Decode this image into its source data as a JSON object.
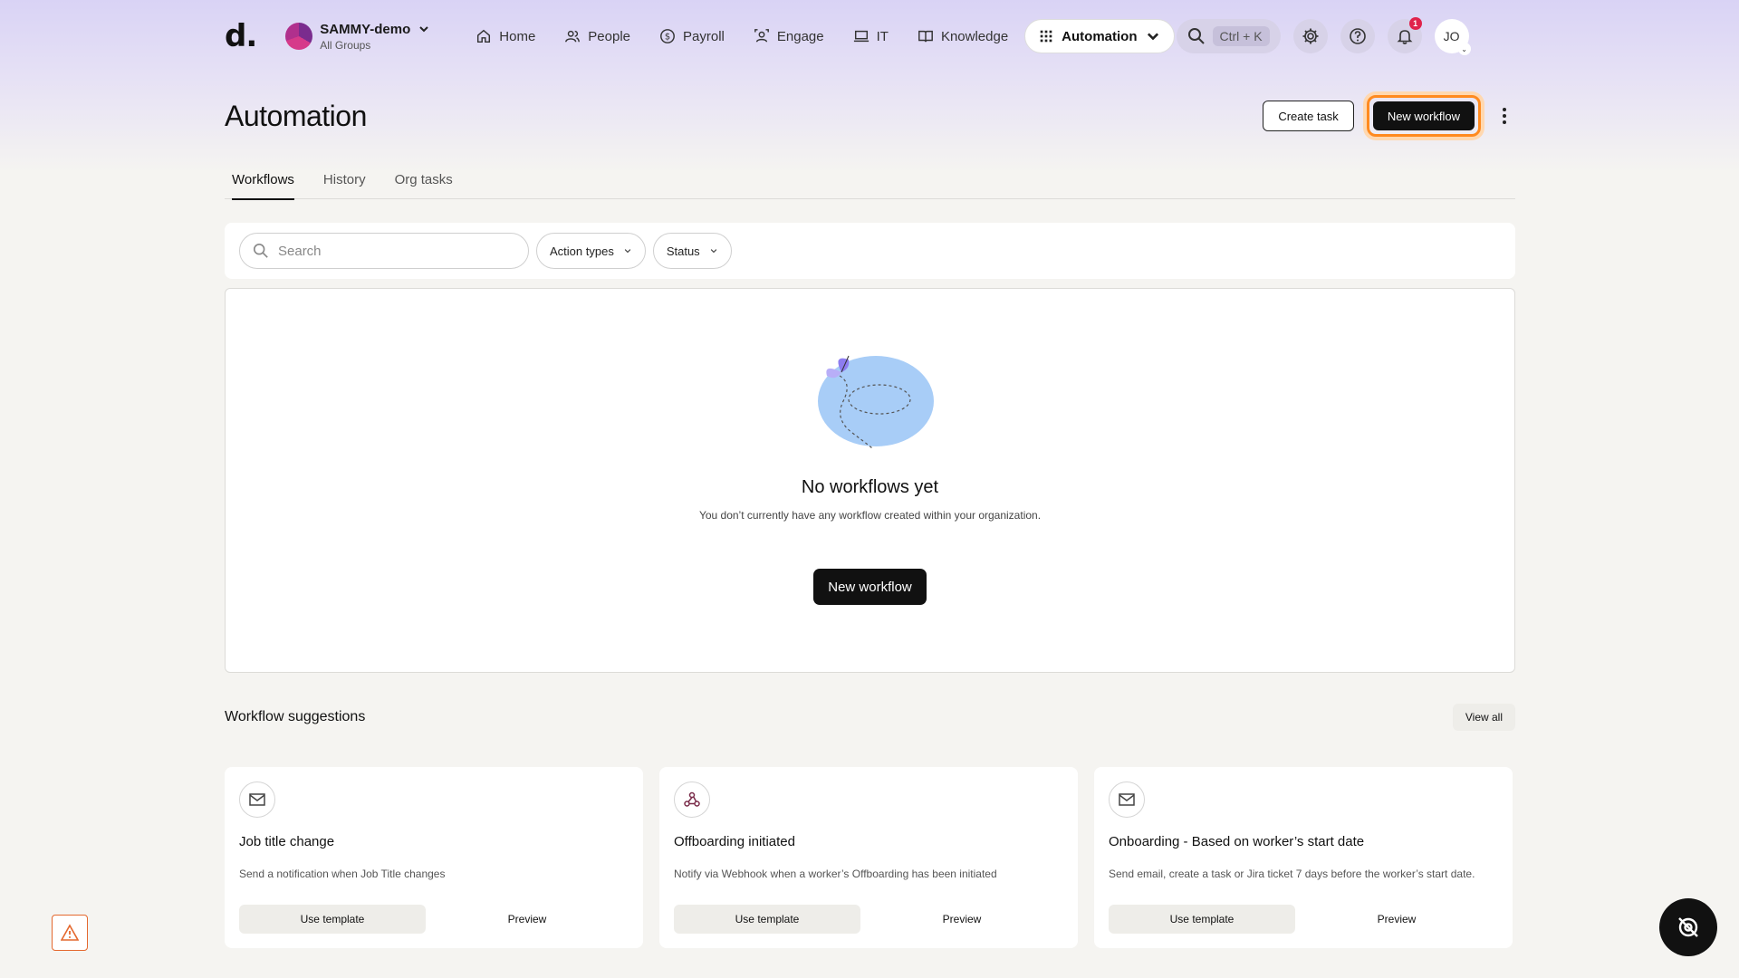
{
  "header": {
    "logo": "d.",
    "org_name": "SAMMY-demo",
    "org_sub": "All Groups",
    "nav": [
      {
        "label": "Home",
        "icon": "home-icon"
      },
      {
        "label": "People",
        "icon": "people-icon"
      },
      {
        "label": "Payroll",
        "icon": "payroll-icon"
      },
      {
        "label": "Engage",
        "icon": "engage-icon"
      },
      {
        "label": "IT",
        "icon": "laptop-icon"
      },
      {
        "label": "Knowledge",
        "icon": "book-icon"
      },
      {
        "label": "Automation",
        "icon": "grid-icon",
        "active": true
      }
    ],
    "search_shortcut": "Ctrl + K",
    "notification_count": "1",
    "user_initials": "JO"
  },
  "page": {
    "title": "Automation",
    "create_task": "Create task",
    "new_workflow": "New workflow"
  },
  "tabs": [
    "Workflows",
    "History",
    "Org tasks"
  ],
  "filters": {
    "search_placeholder": "Search",
    "action_types": "Action types",
    "status": "Status"
  },
  "empty_state": {
    "title": "No workflows yet",
    "description": "You don’t currently have any workflow created within your organization.",
    "button": "New workflow"
  },
  "suggestions": {
    "title": "Workflow suggestions",
    "view_all": "View all",
    "cards": [
      {
        "icon": "mail-icon",
        "title": "Job title change",
        "desc": "Send a notification when Job Title changes",
        "use": "Use template",
        "preview": "Preview"
      },
      {
        "icon": "webhook-icon",
        "title": "Offboarding initiated",
        "desc": "Notify via Webhook when a worker’s Offboarding has been initiated",
        "use": "Use template",
        "preview": "Preview"
      },
      {
        "icon": "mail-icon",
        "title": "Onboarding - Based on worker’s start date",
        "desc": "Send email, create a task or Jira ticket 7 days before the worker’s start date.",
        "use": "Use template",
        "preview": "Preview"
      }
    ]
  },
  "colors": {
    "accent_dark": "#111111",
    "highlight": "#ff8a1f",
    "badge": "#e0224b"
  }
}
